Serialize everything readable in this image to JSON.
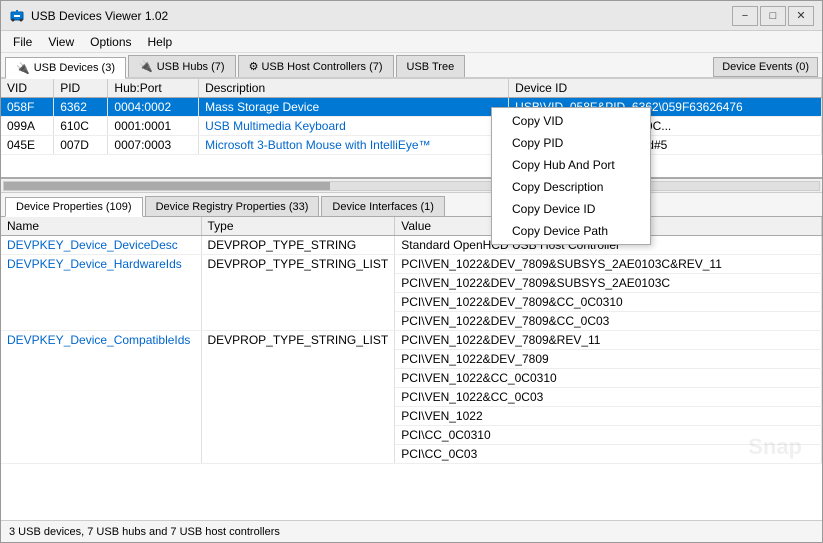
{
  "window": {
    "title": "USB Devices Viewer 1.02",
    "icon": "🔌",
    "min_label": "−",
    "max_label": "□",
    "close_label": "✕"
  },
  "menu": {
    "items": [
      "File",
      "View",
      "Options",
      "Help"
    ]
  },
  "tabs": [
    {
      "id": "usb-devices",
      "label": "USB Devices (3)",
      "icon": "🔌",
      "active": true
    },
    {
      "id": "usb-hubs",
      "label": "USB Hubs (7)",
      "icon": "🔌",
      "active": false
    },
    {
      "id": "usb-host-controllers",
      "label": "⚙ USB Host Controllers (7)",
      "icon": "",
      "active": false
    },
    {
      "id": "usb-tree",
      "label": "USB Tree",
      "icon": "",
      "active": false
    }
  ],
  "device_events_btn": "Device Events (0)",
  "device_table": {
    "headers": [
      "VID",
      "PID",
      "Hub:Port",
      "Description",
      "Device ID"
    ],
    "rows": [
      {
        "vid": "058F",
        "pid": "6362",
        "hub_port": "0004:0002",
        "description": "Mass Storage Device",
        "device_id": "USB\\VID_058F&PID_6362\\059F63626476",
        "selected": true
      },
      {
        "vid": "099A",
        "pid": "610C",
        "hub_port": "0001:0001",
        "description": "USB Multimedia Keyboard",
        "device_id": "USB\\VID_099A&PID_610C...",
        "selected": false
      },
      {
        "vid": "045E",
        "pid": "007D",
        "hub_port": "0007:0003",
        "description": "Microsoft 3-Button Mouse with IntelliEye™",
        "device_id": "USB\\VID_045e&pid_007d#5",
        "selected": false
      }
    ]
  },
  "context_menu": {
    "items": [
      "Copy VID",
      "Copy PID",
      "Copy Hub And Port",
      "Copy Description",
      "Copy Device ID",
      "Copy Device Path"
    ]
  },
  "props_tabs": [
    {
      "label": "Device Properties (109)",
      "active": true
    },
    {
      "label": "Device Registry Properties (33)",
      "active": false
    },
    {
      "label": "Device Interfaces (1)",
      "active": false
    }
  ],
  "props_table": {
    "headers": [
      "Name",
      "Type",
      "Value"
    ],
    "rows": [
      {
        "name": "DEVPKEY_Device_DeviceDesc",
        "type": "DEVPROP_TYPE_STRING",
        "values": [
          "Standard OpenHCD USB Host Controller"
        ]
      },
      {
        "name": "DEVPKEY_Device_HardwareIds",
        "type": "DEVPROP_TYPE_STRING_LIST",
        "values": [
          "PCI\\VEN_1022&DEV_7809&SUBSYS_2AE0103C&REV_11",
          "PCI\\VEN_1022&DEV_7809&SUBSYS_2AE0103C",
          "PCI\\VEN_1022&DEV_7809&CC_0C0310",
          "PCI\\VEN_1022&DEV_7809&CC_0C03"
        ]
      },
      {
        "name": "DEVPKEY_Device_CompatibleIds",
        "type": "DEVPROP_TYPE_STRING_LIST",
        "values": [
          "PCI\\VEN_1022&DEV_7809&REV_11",
          "PCI\\VEN_1022&DEV_7809",
          "PCI\\VEN_1022&CC_0C0310",
          "PCI\\VEN_1022&CC_0C03",
          "PCI\\VEN_1022",
          "PCI\\CC_0C0310",
          "PCI\\CC_0C03"
        ]
      }
    ]
  },
  "status_bar": {
    "text": "3 USB devices, 7 USB hubs and 7 USB host controllers"
  }
}
